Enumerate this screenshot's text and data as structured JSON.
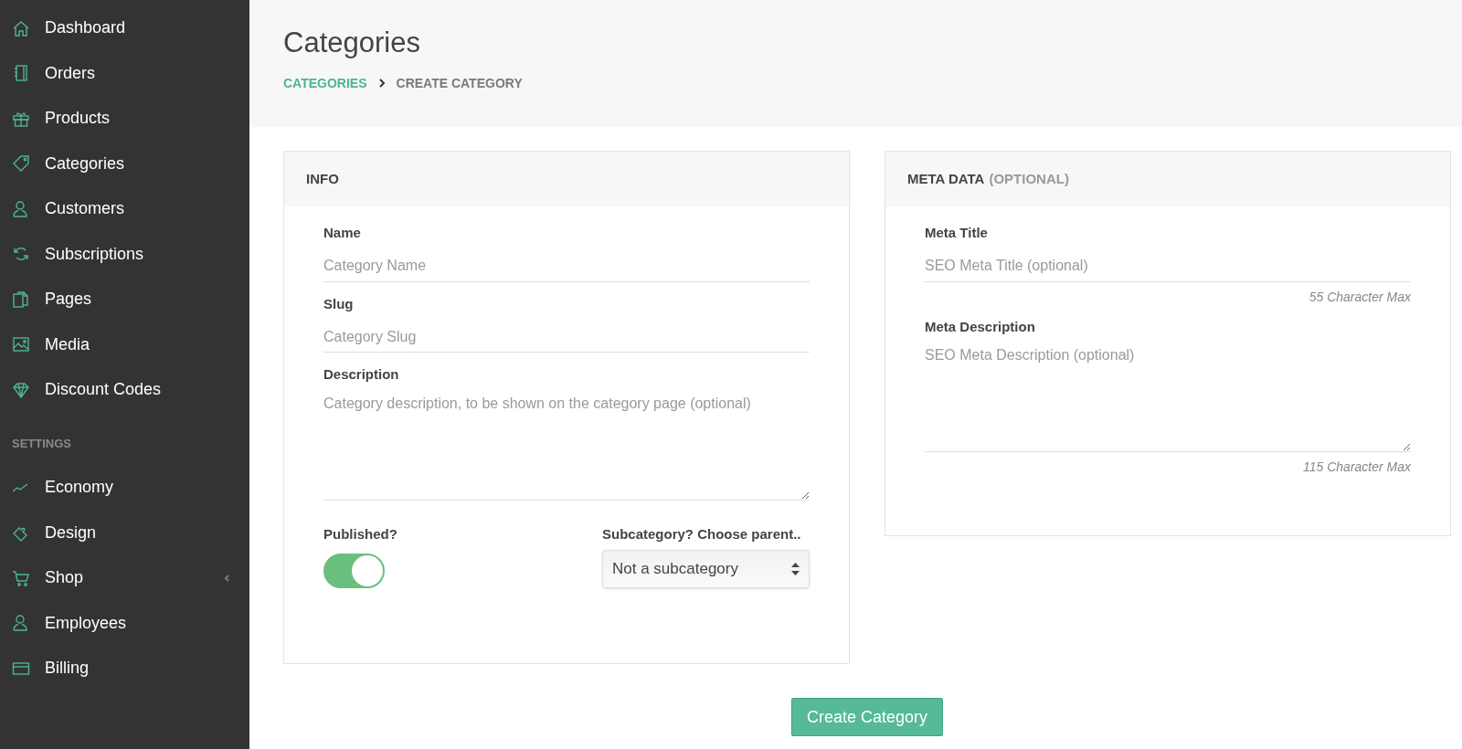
{
  "sidebar": {
    "sections": [
      {
        "items": [
          {
            "kind": "link",
            "label": "Dashboard"
          },
          {
            "kind": "link",
            "label": "Orders"
          },
          {
            "kind": "link",
            "label": "Products"
          },
          {
            "kind": "link",
            "label": "Categories"
          },
          {
            "kind": "link",
            "label": "Customers"
          },
          {
            "kind": "link",
            "label": "Subscriptions"
          },
          {
            "kind": "link",
            "label": "Pages"
          },
          {
            "kind": "link",
            "label": "Media"
          },
          {
            "kind": "link",
            "label": "Discount Codes"
          }
        ]
      },
      {
        "heading": "SETTINGS",
        "items": [
          {
            "kind": "link",
            "label": "Economy"
          },
          {
            "kind": "link",
            "label": "Design"
          },
          {
            "kind": "submenu",
            "label": "Shop",
            "expanded": false
          },
          {
            "kind": "link",
            "label": "Employees"
          },
          {
            "kind": "link",
            "label": "Billing"
          }
        ]
      }
    ]
  },
  "header": {
    "title": "Categories",
    "breadcrumb": [
      {
        "label": "CATEGORIES",
        "link": true
      },
      {
        "label": "CREATE CATEGORY",
        "link": false
      }
    ]
  },
  "info": {
    "title": "INFO",
    "fields": [
      {
        "kind": "text",
        "label": "Name",
        "placeholder": "Category Name"
      },
      {
        "kind": "text",
        "label": "Slug",
        "placeholder": "Category Slug"
      },
      {
        "kind": "textarea",
        "label": "Description",
        "placeholder": "Category description, to be shown on the category page (optional)"
      }
    ],
    "published": {
      "label": "Published?",
      "on": true
    },
    "parent": {
      "label": "Subcategory? Choose parent..",
      "value": "Not a subcategory"
    }
  },
  "meta": {
    "title": "META DATA",
    "title_note": "(OPTIONAL)",
    "fields": [
      {
        "kind": "text",
        "label": "Meta Title",
        "placeholder": "SEO Meta Title (optional)",
        "hint": "55 Character Max"
      },
      {
        "kind": "textarea",
        "label": "Meta Description",
        "placeholder": "SEO Meta Description (optional)",
        "hint": "115 Character Max"
      }
    ]
  },
  "submit": "Create Category"
}
